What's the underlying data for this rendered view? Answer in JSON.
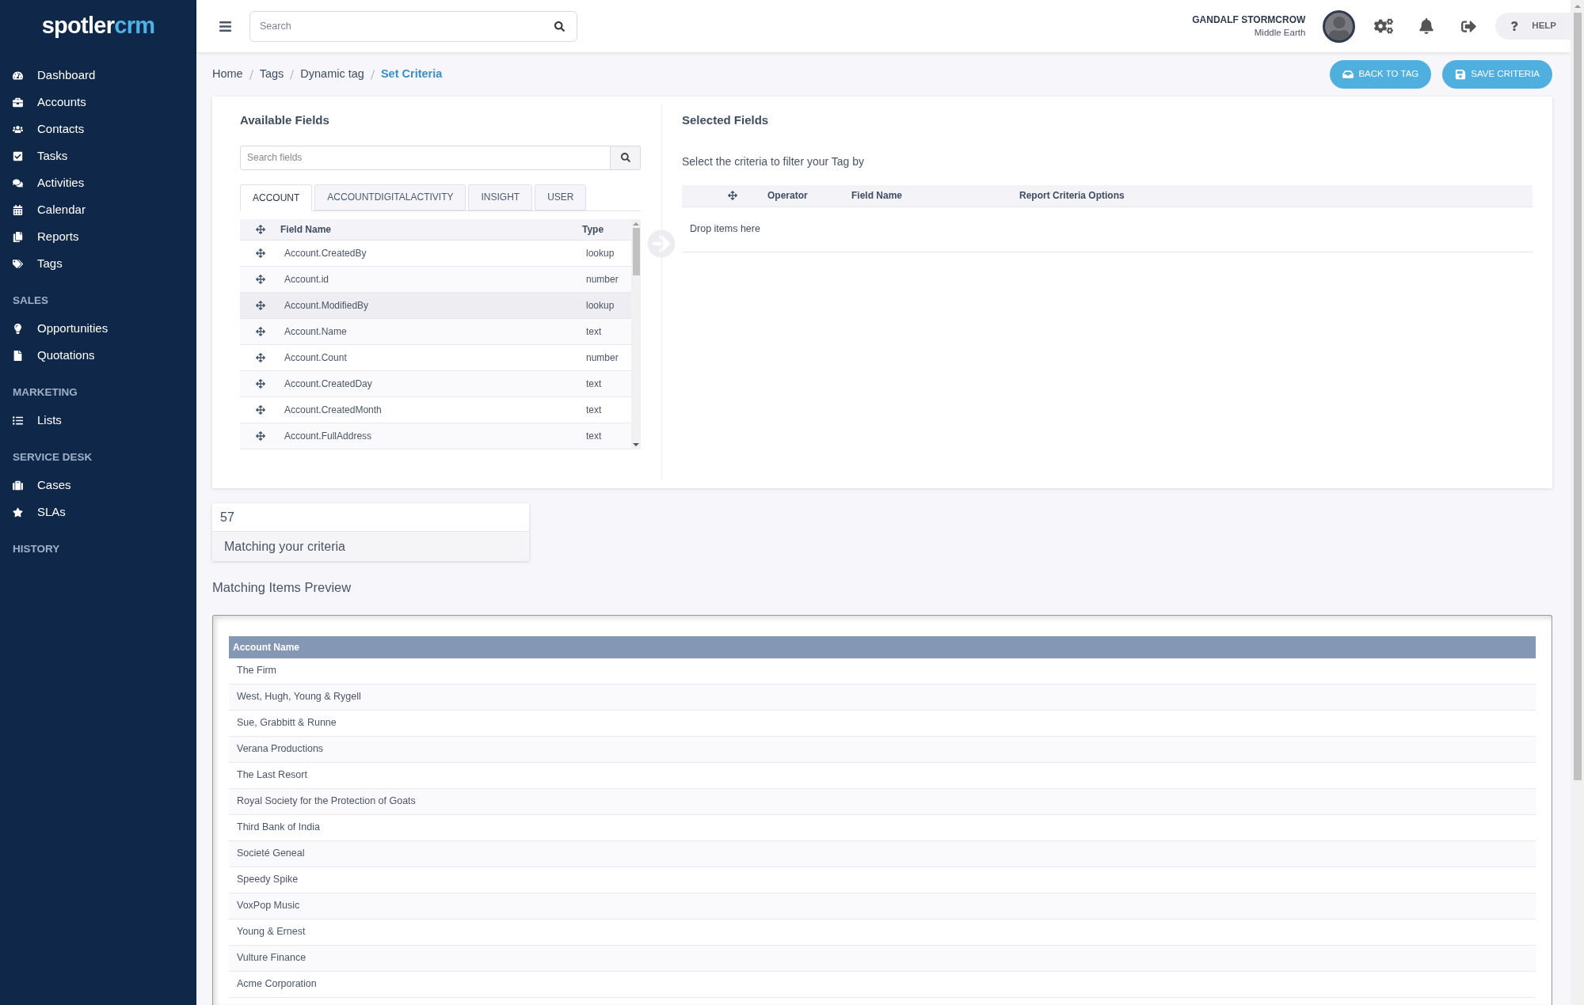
{
  "logo": {
    "part1": "spotler",
    "part2": "crm"
  },
  "sidebar": {
    "items": [
      {
        "kind": "link",
        "label": "Dashboard"
      },
      {
        "kind": "link",
        "label": "Accounts"
      },
      {
        "kind": "link",
        "label": "Contacts"
      },
      {
        "kind": "link",
        "label": "Tasks"
      },
      {
        "kind": "link",
        "label": "Activities"
      },
      {
        "kind": "link",
        "label": "Calendar"
      },
      {
        "kind": "link",
        "label": "Reports"
      },
      {
        "kind": "link",
        "label": "Tags"
      },
      {
        "kind": "heading",
        "label": "SALES"
      },
      {
        "kind": "link",
        "label": "Opportunities"
      },
      {
        "kind": "link",
        "label": "Quotations"
      },
      {
        "kind": "heading",
        "label": "MARKETING"
      },
      {
        "kind": "link",
        "label": "Lists"
      },
      {
        "kind": "heading",
        "label": "SERVICE DESK"
      },
      {
        "kind": "link",
        "label": "Cases"
      },
      {
        "kind": "link",
        "label": "SLAs"
      },
      {
        "kind": "heading",
        "label": "HISTORY"
      }
    ]
  },
  "topbar": {
    "search": {
      "placeholder": "Search"
    },
    "user": {
      "name": "GANDALF STORMCROW",
      "location": "Middle Earth"
    },
    "help": "HELP"
  },
  "breadcrumbs": [
    {
      "label": "Home",
      "current": false
    },
    {
      "label": "Tags",
      "current": false
    },
    {
      "label": "Dynamic tag",
      "current": false
    },
    {
      "label": "Set Criteria",
      "current": true
    }
  ],
  "actions": [
    "BACK TO TAG",
    "SAVE CRITERIA"
  ],
  "available_fields": {
    "title": "Available Fields",
    "search": {
      "placeholder": "Search fields"
    },
    "tabs": [
      {
        "label": "ACCOUNT",
        "selected": true
      },
      {
        "label": "ACCOUNTDIGITALACTIVITY",
        "selected": false
      },
      {
        "label": "INSIGHT",
        "selected": false
      },
      {
        "label": "USER",
        "selected": false
      }
    ],
    "columns": [
      "Field Name",
      "Type"
    ],
    "rows": [
      {
        "name": "Account.CreatedBy",
        "type": "lookup",
        "hovered": false
      },
      {
        "name": "Account.id",
        "type": "number",
        "hovered": false
      },
      {
        "name": "Account.ModifiedBy",
        "type": "lookup",
        "hovered": true
      },
      {
        "name": "Account.Name",
        "type": "text",
        "hovered": false
      },
      {
        "name": "Account.Count",
        "type": "number",
        "hovered": false
      },
      {
        "name": "Account.CreatedDay",
        "type": "text",
        "hovered": false
      },
      {
        "name": "Account.CreatedMonth",
        "type": "text",
        "hovered": false
      },
      {
        "name": "Account.FullAddress",
        "type": "text",
        "hovered": false
      }
    ]
  },
  "selected_fields": {
    "title": "Selected Fields",
    "hint": "Select the criteria to filter your Tag by",
    "columns": [
      "Operator",
      "Field Name",
      "Report Criteria Options"
    ],
    "empty": "Drop items here"
  },
  "match": {
    "count": "57",
    "label": "Matching your criteria"
  },
  "preview": {
    "title": "Matching Items Preview",
    "column": "Account Name",
    "rows": [
      "The Firm",
      "West, Hugh, Young & Rygell",
      "Sue, Grabbitt & Runne",
      "Verana Productions",
      "The Last Resort",
      "Royal Society for the Protection of Goats",
      "Third Bank of India",
      "Societé Geneal",
      "Speedy Spike",
      "VoxPop Music",
      "Young & Ernest",
      "Vulture Finance",
      "Acme Corporation"
    ]
  }
}
